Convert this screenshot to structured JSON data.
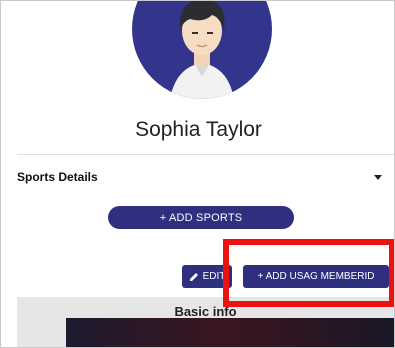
{
  "profile": {
    "name": "Sophia Taylor"
  },
  "section": {
    "title": "Sports Details"
  },
  "buttons": {
    "add_sports": "+ ADD SPORTS",
    "edit": "EDIT",
    "add_usag": "+ ADD USAG MEMBERID"
  },
  "basic_info": {
    "label": "Basic info"
  },
  "colors": {
    "primary": "#2f2f80",
    "highlight": "#ee1111"
  }
}
